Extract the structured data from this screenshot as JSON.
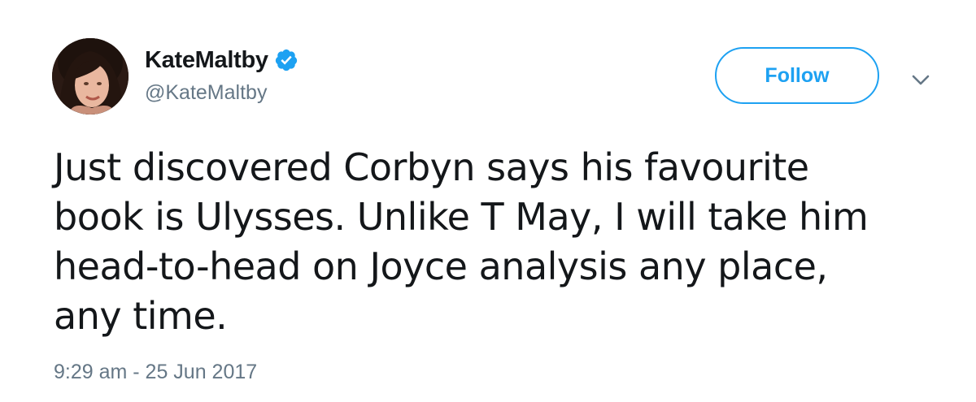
{
  "user": {
    "display_name": "KateMaltby",
    "handle": "@KateMaltby",
    "verified": true,
    "verified_icon": "verified-badge-icon",
    "avatar_icon": "profile-photo"
  },
  "actions": {
    "follow_label": "Follow",
    "menu_icon": "chevron-down-icon"
  },
  "tweet": {
    "lines": [
      "Just discovered Corbyn says his favourite",
      "book is Ulysses. Unlike T May, I will take him",
      "head-to-head on Joyce analysis any place,",
      "any time."
    ],
    "timestamp": "9:29 am - 25 Jun 2017"
  },
  "colors": {
    "accent": "#1da1f2",
    "text": "#14171a",
    "secondary": "#657786"
  }
}
